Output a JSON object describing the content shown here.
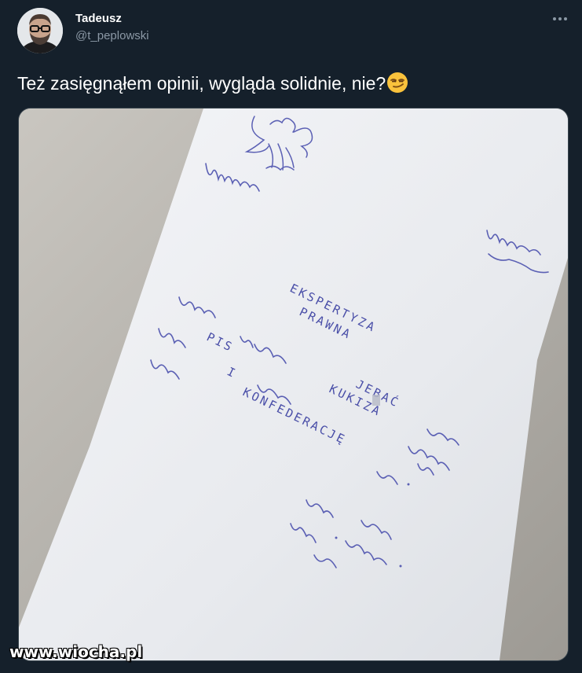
{
  "tweet": {
    "author": {
      "display_name": "Tadeusz",
      "handle": "@t_peplowski"
    },
    "text": "Też zasięgnąłem opinii, wygląda solidnie, nie?",
    "emoji": "smirking-face-emoji",
    "more_icon": "more-dots-icon"
  },
  "media": {
    "document": {
      "title_line1": "EKSPERTYZA",
      "title_line2": "PRAWNA",
      "words": [
        "JEBAĆ",
        "PIS",
        "KUKIZA",
        "I",
        "KONFEDERACJĘ"
      ]
    }
  },
  "watermark": "www.wiocha.pl",
  "colors": {
    "background": "#15202b",
    "secondary_text": "#8b98a5",
    "border": "#38444d",
    "paper": "#eef0f3",
    "ink": "#4a4fa8"
  }
}
